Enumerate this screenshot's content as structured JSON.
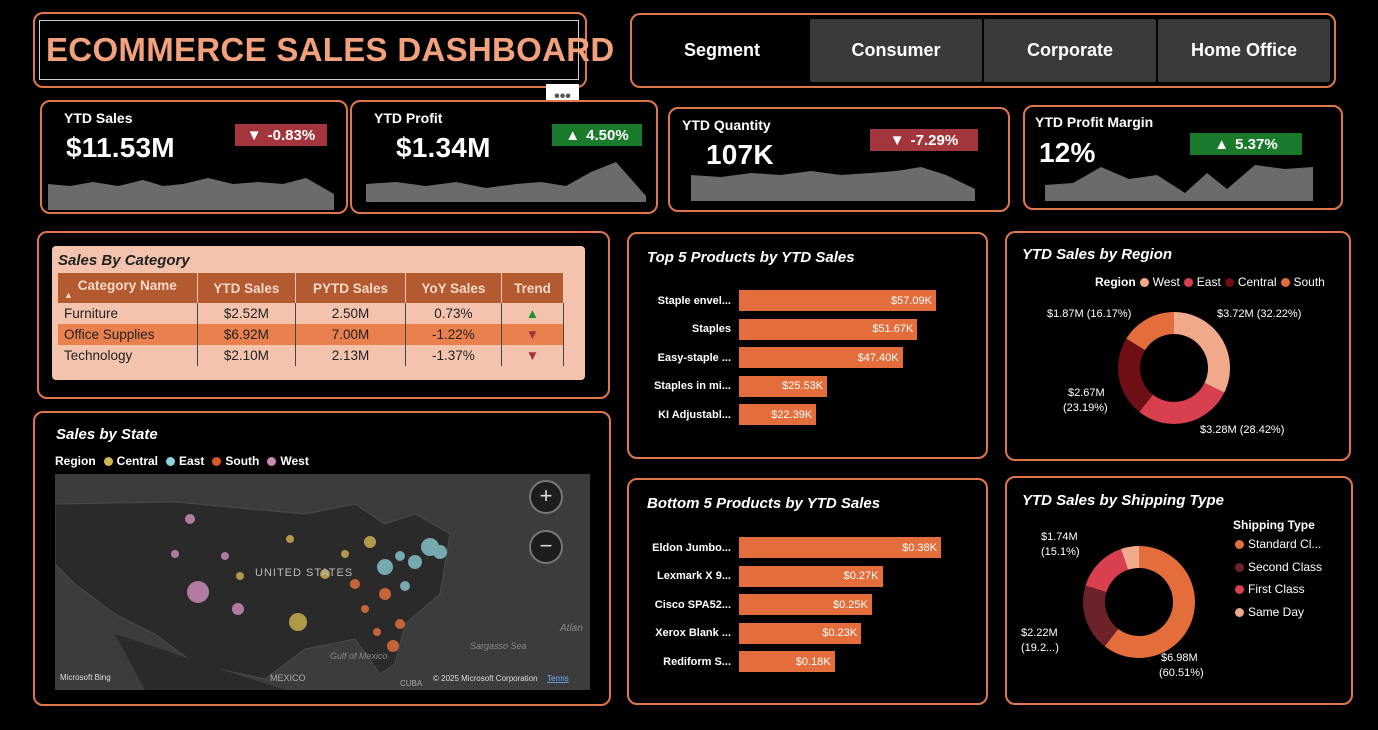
{
  "header": {
    "title": "ECOMMERCE SALES DASHBOARD",
    "more_glyph": "•••"
  },
  "segments": {
    "label": "Segment",
    "options": [
      "Consumer",
      "Corporate",
      "Home Office"
    ]
  },
  "kpis": {
    "sales": {
      "label": "YTD Sales",
      "value": "$11.53M",
      "delta": "-0.83%",
      "direction": "down"
    },
    "profit": {
      "label": "YTD Profit",
      "value": "$1.34M",
      "delta": "4.50%",
      "direction": "up"
    },
    "quantity": {
      "label": "YTD Quantity",
      "value": "107K",
      "delta": "-7.29%",
      "direction": "down"
    },
    "margin": {
      "label": "YTD Profit Margin",
      "value": "12%",
      "delta": "5.37%",
      "direction": "up"
    },
    "up_glyph": "▲",
    "down_glyph": "▼"
  },
  "category_table": {
    "title": "Sales By Category",
    "columns": [
      "Category Name",
      "YTD Sales",
      "PYTD Sales",
      "YoY Sales",
      "Trend"
    ],
    "rows": [
      {
        "name": "Furniture",
        "ytd": "$2.52M",
        "pytd": "2.50M",
        "yoy": "0.73%",
        "trend": "▲"
      },
      {
        "name": "Office Supplies",
        "ytd": "$6.92M",
        "pytd": "7.00M",
        "yoy": "-1.22%",
        "trend": "▼"
      },
      {
        "name": "Technology",
        "ytd": "$2.10M",
        "pytd": "2.13M",
        "yoy": "-1.37%",
        "trend": "▼"
      }
    ]
  },
  "state_map": {
    "title": "Sales by State",
    "legend_title": "Region",
    "legend": [
      "Central",
      "East",
      "South",
      "West"
    ],
    "labels": {
      "country": "UNITED STATES",
      "mexico": "MEXICO",
      "gulf": "Gulf of Mexico",
      "sargasso": "Sargasso Sea",
      "atlantic": "Atlan",
      "cuba": "CUBA",
      "bing": "Microsoft Bing",
      "copyright": "© 2025 Microsoft Corporation",
      "terms": "Terms"
    },
    "zoom_in": "+",
    "zoom_out": "−"
  },
  "top5": {
    "title": "Top 5 Products by YTD Sales",
    "items": [
      {
        "label": "Staple envel...",
        "value": 57.09,
        "text": "$57.09K"
      },
      {
        "label": "Staples",
        "value": 51.67,
        "text": "$51.67K"
      },
      {
        "label": "Easy-staple ...",
        "value": 47.4,
        "text": "$47.40K"
      },
      {
        "label": "Staples in mi...",
        "value": 25.53,
        "text": "$25.53K"
      },
      {
        "label": "KI Adjustabl...",
        "value": 22.39,
        "text": "$22.39K"
      }
    ]
  },
  "bottom5": {
    "title": "Bottom 5 Products by YTD Sales",
    "items": [
      {
        "label": "Eldon Jumbo...",
        "value": 0.38,
        "text": "$0.38K"
      },
      {
        "label": "Lexmark X 9...",
        "value": 0.27,
        "text": "$0.27K"
      },
      {
        "label": "Cisco SPA52...",
        "value": 0.25,
        "text": "$0.25K"
      },
      {
        "label": "Xerox Blank ...",
        "value": 0.23,
        "text": "$0.23K"
      },
      {
        "label": "Rediform S...",
        "value": 0.18,
        "text": "$0.18K"
      }
    ]
  },
  "region_donut": {
    "title": "YTD Sales by Region",
    "legend_title": "Region",
    "slices": [
      {
        "name": "West",
        "value": 3.72,
        "label": "$3.72M (32.22%)",
        "color": "#f0a98a"
      },
      {
        "name": "East",
        "value": 3.28,
        "label": "$3.28M (28.42%)",
        "color": "#d9404f"
      },
      {
        "name": "Central",
        "value": 2.67,
        "label_a": "$2.67M",
        "label_b": "(23.19%)",
        "color": "#6e0f16"
      },
      {
        "name": "South",
        "value": 1.87,
        "label": "$1.87M (16.17%)",
        "color": "#e36d3b"
      }
    ]
  },
  "shipping_donut": {
    "title": "YTD Sales by Shipping Type",
    "legend_title": "Shipping Type",
    "slices": [
      {
        "name": "Standard Cl...",
        "value": 6.98,
        "label_a": "$6.98M",
        "label_b": "(60.51%)",
        "color": "#e36d3b"
      },
      {
        "name": "Second Class",
        "value": 2.22,
        "label_a": "$2.22M",
        "label_b": "(19.2...)",
        "color": "#6b2228"
      },
      {
        "name": "First Class",
        "value": 1.74,
        "label_a": "$1.74M",
        "label_b": "(15.1%)",
        "color": "#d9404f"
      },
      {
        "name": "Same Day",
        "value": 0.6,
        "color": "#f0a98a"
      }
    ]
  },
  "chart_data": [
    {
      "type": "bar",
      "title": "Top 5 Products by YTD Sales",
      "categories": [
        "Staple envel...",
        "Staples",
        "Easy-staple ...",
        "Staples in mi...",
        "KI Adjustabl..."
      ],
      "values": [
        57.09,
        51.67,
        47.4,
        25.53,
        22.39
      ]
    },
    {
      "type": "bar",
      "title": "Bottom 5 Products by YTD Sales",
      "categories": [
        "Eldon Jumbo...",
        "Lexmark X 9...",
        "Cisco SPA52...",
        "Xerox Blank ...",
        "Rediform S..."
      ],
      "values": [
        0.38,
        0.27,
        0.25,
        0.23,
        0.18
      ]
    },
    {
      "type": "pie",
      "title": "YTD Sales by Region",
      "categories": [
        "West",
        "East",
        "Central",
        "South"
      ],
      "values": [
        3.72,
        3.28,
        2.67,
        1.87
      ]
    },
    {
      "type": "pie",
      "title": "YTD Sales by Shipping Type",
      "categories": [
        "Standard Cl...",
        "Second Class",
        "First Class",
        "Same Day"
      ],
      "values": [
        6.98,
        2.22,
        1.74,
        0.6
      ]
    }
  ]
}
